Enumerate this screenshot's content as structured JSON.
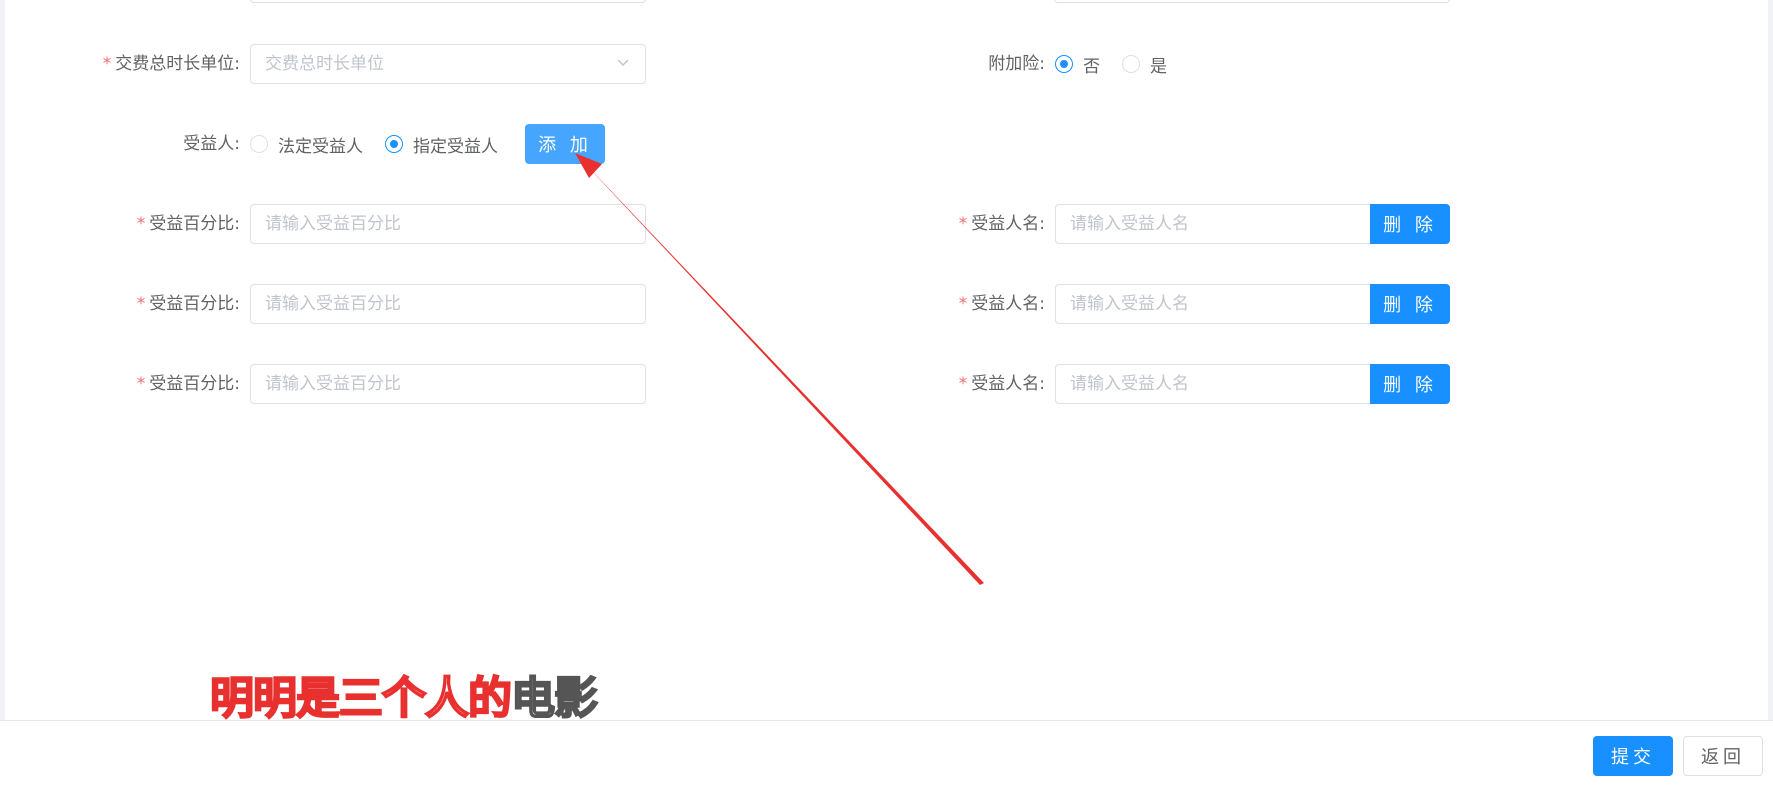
{
  "form": {
    "payment_unit": {
      "label": "交费总时长单位:",
      "placeholder": "交费总时长单位",
      "required": true
    },
    "additional_insurance": {
      "label": "附加险:",
      "options": [
        {
          "label": "否",
          "checked": true
        },
        {
          "label": "是",
          "checked": false
        }
      ]
    },
    "beneficiary": {
      "label": "受益人:",
      "options": [
        {
          "label": "法定受益人",
          "checked": false
        },
        {
          "label": "指定受益人",
          "checked": true
        }
      ],
      "add_label": "添 加"
    },
    "beneficiary_rows": [
      {
        "percent_label": "受益百分比:",
        "percent_placeholder": "请输入受益百分比",
        "name_label": "受益人名:",
        "name_placeholder": "请输入受益人名",
        "delete_label": "删 除"
      },
      {
        "percent_label": "受益百分比:",
        "percent_placeholder": "请输入受益百分比",
        "name_label": "受益人名:",
        "name_placeholder": "请输入受益人名",
        "delete_label": "删 除"
      },
      {
        "percent_label": "受益百分比:",
        "percent_placeholder": "请输入受益百分比",
        "name_label": "受益人名:",
        "name_placeholder": "请输入受益人名",
        "delete_label": "删 除"
      }
    ]
  },
  "footer": {
    "submit_label": "提交",
    "back_label": "返回"
  },
  "subtitle": {
    "red_part": "明明是三个人的",
    "gray_part": "电影"
  },
  "colors": {
    "primary": "#1890ff",
    "required": "#f56c6c",
    "arrow": "#e8312f"
  }
}
